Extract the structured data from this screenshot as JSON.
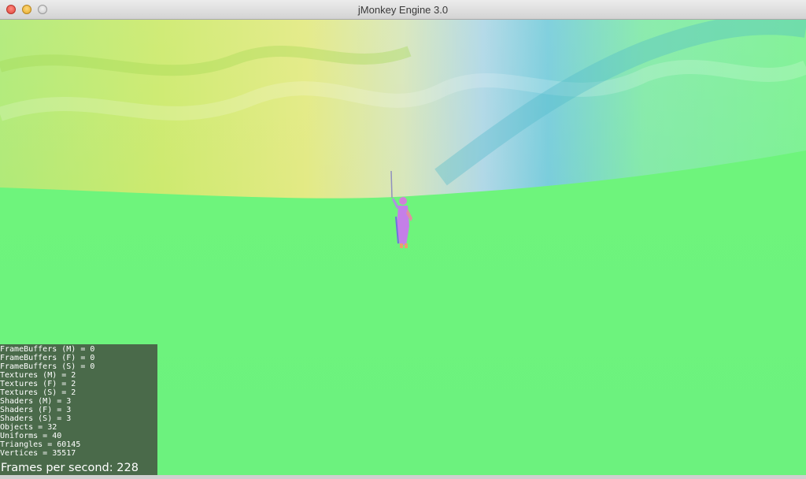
{
  "window": {
    "title": "jMonkey Engine 3.0"
  },
  "stats": {
    "lines": [
      "FrameBuffers (M) = 0",
      "FrameBuffers (F) = 0",
      "FrameBuffers (S) = 0",
      "Textures (M) = 2",
      "Textures (F) = 2",
      "Textures (S) = 2",
      "Shaders (M) = 3",
      "Shaders (F) = 3",
      "Shaders (S) = 3",
      "Objects = 32",
      "Uniforms = 40",
      "Triangles = 60145",
      "Vertices = 35517"
    ],
    "fps": "Frames per second: 228"
  },
  "colors": {
    "ground": "#6cf47e",
    "stats_background": "#4a6a4a",
    "sky_yellow": "#c8e860",
    "sky_cyan": "#7ed8dc",
    "character": "#c47fe8"
  },
  "icons": {
    "close": "close-icon",
    "minimize": "minimize-icon",
    "zoom": "zoom-icon"
  }
}
